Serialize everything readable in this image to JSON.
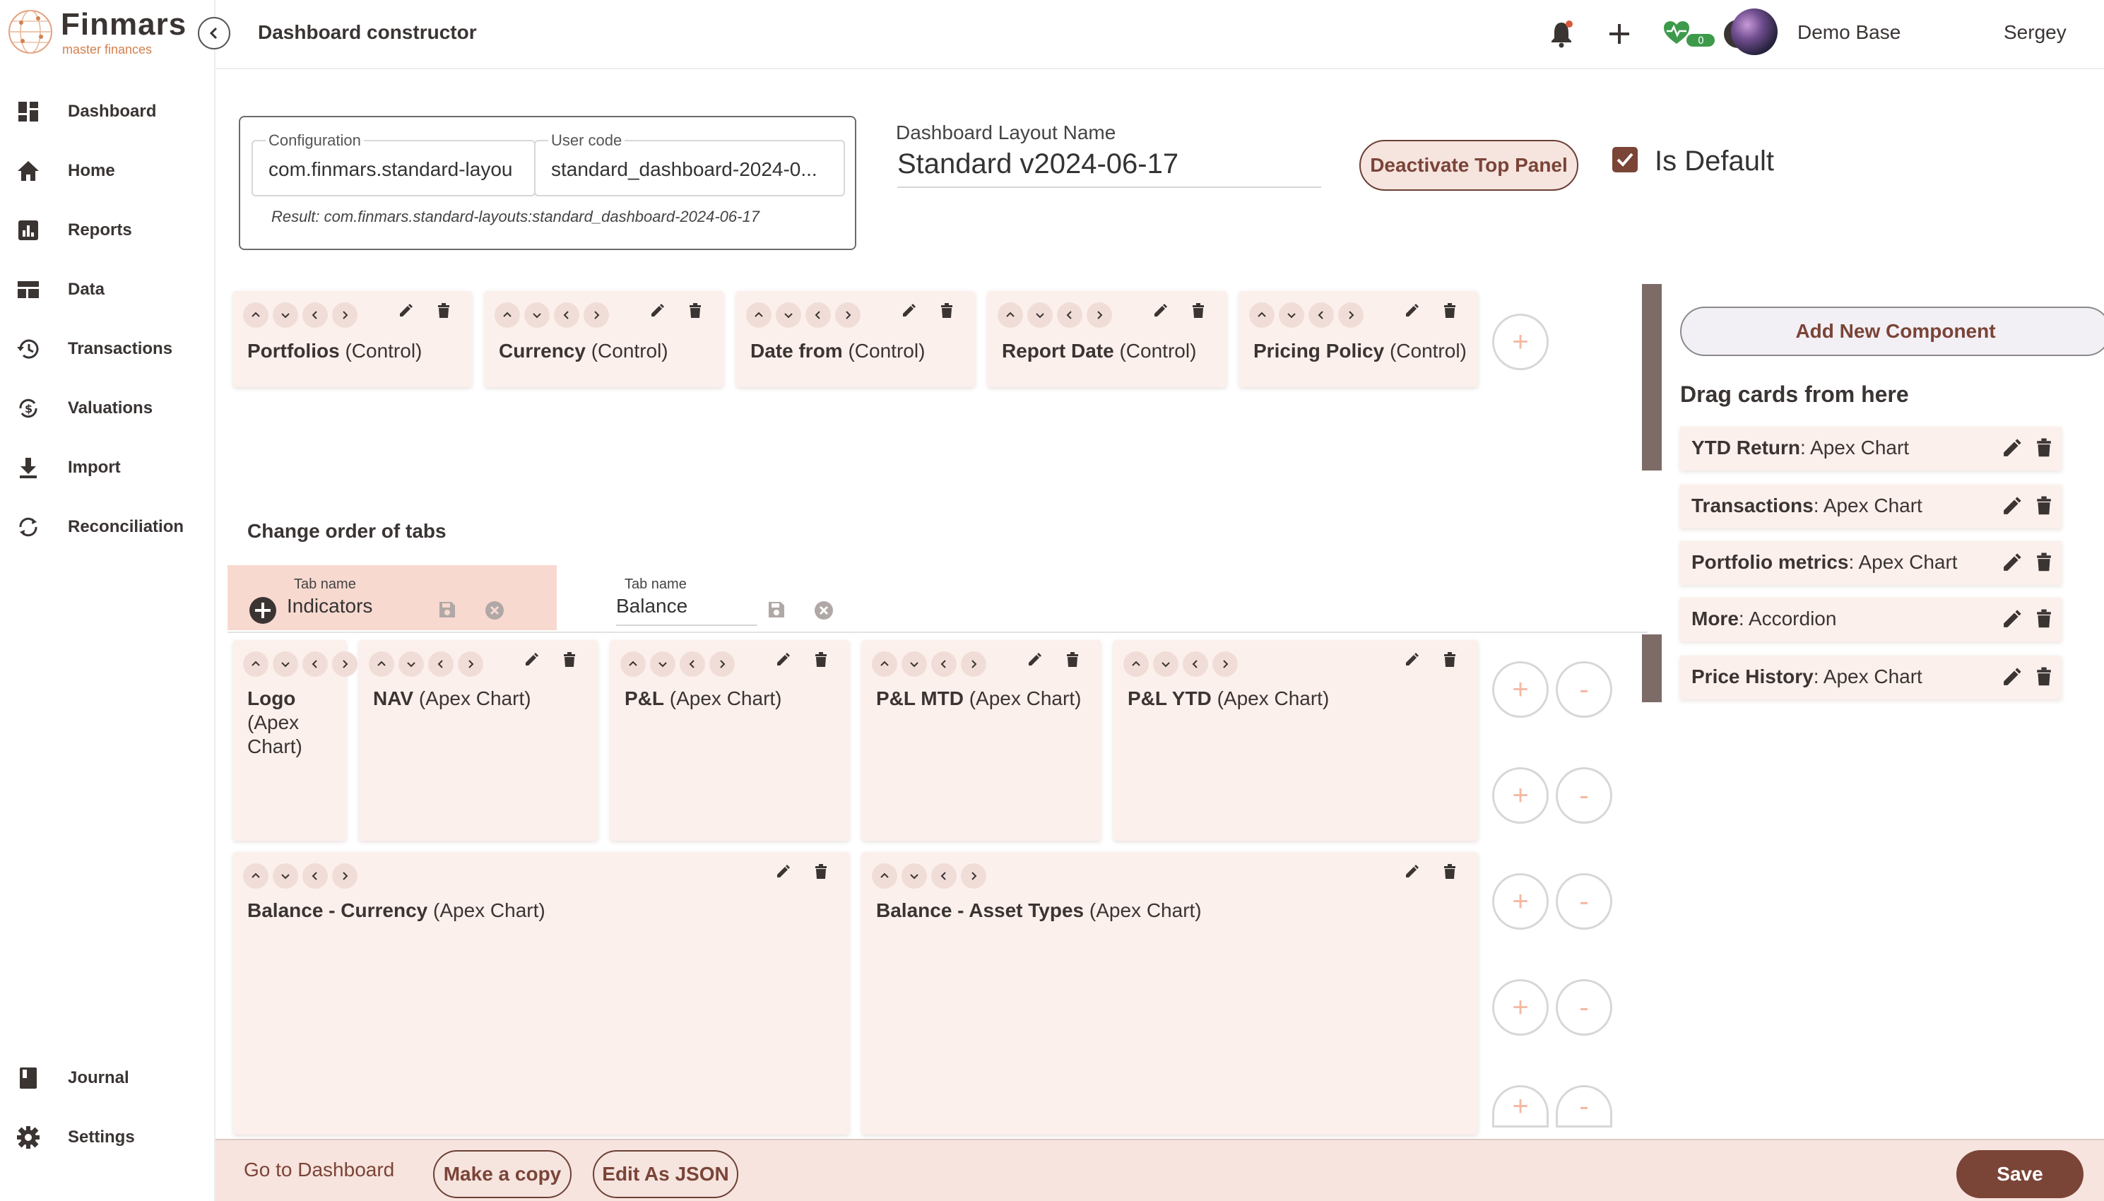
{
  "app": {
    "logo_name": "Finmars",
    "logo_tagline": "master finances",
    "page_title": "Dashboard constructor"
  },
  "sidebar": {
    "items": [
      {
        "label": "Dashboard",
        "icon": "dashboard-icon"
      },
      {
        "label": "Home",
        "icon": "home-icon"
      },
      {
        "label": "Reports",
        "icon": "reports-icon"
      },
      {
        "label": "Data",
        "icon": "data-icon"
      },
      {
        "label": "Transactions",
        "icon": "history-icon"
      },
      {
        "label": "Valuations",
        "icon": "valuations-icon"
      },
      {
        "label": "Import",
        "icon": "download-icon"
      },
      {
        "label": "Reconciliation",
        "icon": "sync-icon"
      }
    ],
    "bottom_items": [
      {
        "label": "Journal",
        "icon": "book-icon"
      },
      {
        "label": "Settings",
        "icon": "gear-icon"
      }
    ]
  },
  "topbar": {
    "workspace": "Demo Base",
    "user_name": "Sergey",
    "status_badge": "0"
  },
  "config": {
    "configuration_label": "Configuration",
    "configuration_value": "com.finmars.standard-layou",
    "user_code_label": "User code",
    "user_code_value": "standard_dashboard-2024-0...",
    "result": "Result: com.finmars.standard-layouts:standard_dashboard-2024-06-17"
  },
  "layout": {
    "name_label": "Dashboard Layout Name",
    "name_value": "Standard v2024-06-17",
    "deactivate_label": "Deactivate Top Panel",
    "is_default_label": "Is Default",
    "is_default": true
  },
  "top_panel_cards": [
    {
      "name": "Portfolios",
      "type": "(Control)"
    },
    {
      "name": "Currency",
      "type": "(Control)"
    },
    {
      "name": "Date from",
      "type": "(Control)"
    },
    {
      "name": "Report Date",
      "type": "(Control)"
    },
    {
      "name": "Pricing Policy",
      "type": "(Control)"
    }
  ],
  "tabs_section": {
    "label": "Change order of tabs",
    "tab_name_label": "Tab name",
    "tabs": [
      {
        "name": "Indicators",
        "active": true
      },
      {
        "name": "Balance",
        "active": false
      }
    ]
  },
  "grid_row1": [
    {
      "name": "Logo",
      "type": "(Apex Chart)"
    },
    {
      "name": "NAV",
      "type": "(Apex Chart)"
    },
    {
      "name": "P&L",
      "type": "(Apex Chart)"
    },
    {
      "name": "P&L MTD",
      "type": "(Apex Chart)"
    },
    {
      "name": "P&L YTD",
      "type": "(Apex Chart)"
    }
  ],
  "grid_row2": [
    {
      "name": "Balance - Currency",
      "type": "(Apex Chart)"
    },
    {
      "name": "Balance - Asset Types",
      "type": "(Apex Chart)"
    }
  ],
  "right_panel": {
    "add_button": "Add New Component",
    "drag_title": "Drag cards from here",
    "cards": [
      {
        "name": "YTD Return",
        "type": ": Apex Chart"
      },
      {
        "name": "Transactions",
        "type": ": Apex Chart"
      },
      {
        "name": "Portfolio metrics",
        "type": ": Apex Chart"
      },
      {
        "name": "More",
        "type": ": Accordion"
      },
      {
        "name": "Price History",
        "type": ": Apex Chart"
      }
    ]
  },
  "footer": {
    "go_to_dashboard": "Go to Dashboard",
    "make_copy": "Make a copy",
    "edit_json": "Edit As JSON",
    "save": "Save"
  },
  "colors": {
    "accent": "#7a4437",
    "card_bg": "#fcf0ec",
    "active_tab_bg": "#f8d9cf",
    "plus_icon": "#f4b9a3"
  }
}
